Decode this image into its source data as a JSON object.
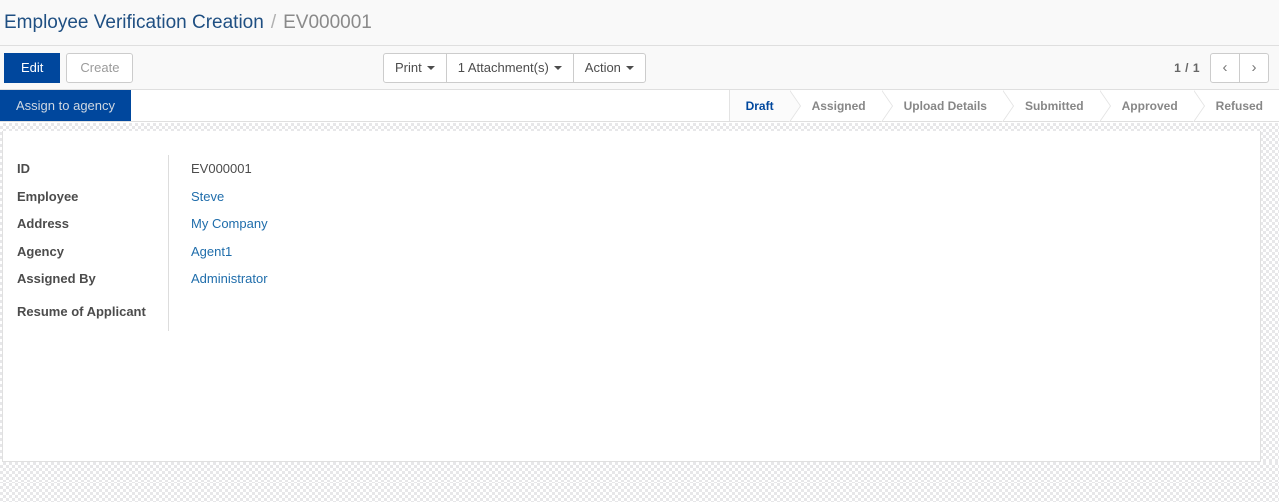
{
  "breadcrumb": {
    "parent": "Employee Verification Creation",
    "separator": "/",
    "current": "EV000001"
  },
  "control_panel": {
    "edit_label": "Edit",
    "create_label": "Create",
    "print_label": "Print",
    "attachments_label": "1 Attachment(s)",
    "action_label": "Action",
    "pager_count": "1 / 1",
    "prev_icon": "chevron-left-icon",
    "next_icon": "chevron-right-icon"
  },
  "statusbar": {
    "action_button": "Assign to agency",
    "stages": [
      {
        "label": "Draft",
        "active": true
      },
      {
        "label": "Assigned",
        "active": false
      },
      {
        "label": "Upload Details",
        "active": false
      },
      {
        "label": "Submitted",
        "active": false
      },
      {
        "label": "Approved",
        "active": false
      },
      {
        "label": "Refused",
        "active": false
      }
    ]
  },
  "form": {
    "fields": [
      {
        "label": "ID",
        "value": "EV000001",
        "link": false
      },
      {
        "label": "Employee",
        "value": "Steve",
        "link": true
      },
      {
        "label": "Address",
        "value": "My Company",
        "link": true
      },
      {
        "label": "Agency",
        "value": "Agent1",
        "link": true
      },
      {
        "label": "Assigned By",
        "value": "Administrator",
        "link": true
      },
      {
        "label": "Resume of Applicant",
        "value": "",
        "link": false
      }
    ]
  },
  "colors": {
    "primary": "#00479d",
    "link": "#1f6dab",
    "breadcrumb_link": "#1f4f82",
    "muted": "#878787",
    "panel_bg": "#f9f9f9"
  }
}
